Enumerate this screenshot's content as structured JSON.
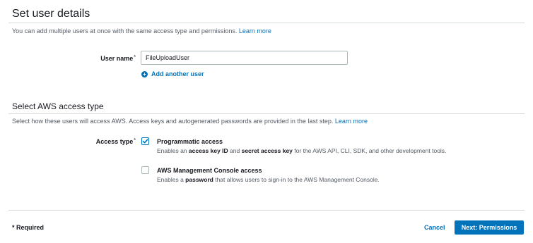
{
  "details": {
    "title": "Set user details",
    "description": "You can add multiple users at once with the same access type and permissions.",
    "learn_more": "Learn more",
    "user_name_label": "User name",
    "required_mark": "*",
    "user_name_value": "FileUploadUser",
    "add_another_user": "Add another user"
  },
  "access": {
    "title": "Select AWS access type",
    "description": "Select how these users will access AWS. Access keys and autogenerated passwords are provided in the last step.",
    "learn_more": "Learn more",
    "access_type_label": "Access type",
    "options": [
      {
        "title": "Programmatic access",
        "checked": true,
        "desc_parts": [
          "Enables an ",
          "access key ID",
          " and ",
          "secret access key",
          " for the AWS API, CLI, SDK, and other development tools."
        ]
      },
      {
        "title": "AWS Management Console access",
        "checked": false,
        "desc_parts": [
          "Enables a ",
          "password",
          " that allows users to sign-in to the AWS Management Console."
        ]
      }
    ]
  },
  "footer": {
    "required_note": "* Required",
    "cancel_label": "Cancel",
    "next_label": "Next: Permissions"
  },
  "colors": {
    "accent": "#0073bb",
    "border": "#d5dbdb"
  }
}
